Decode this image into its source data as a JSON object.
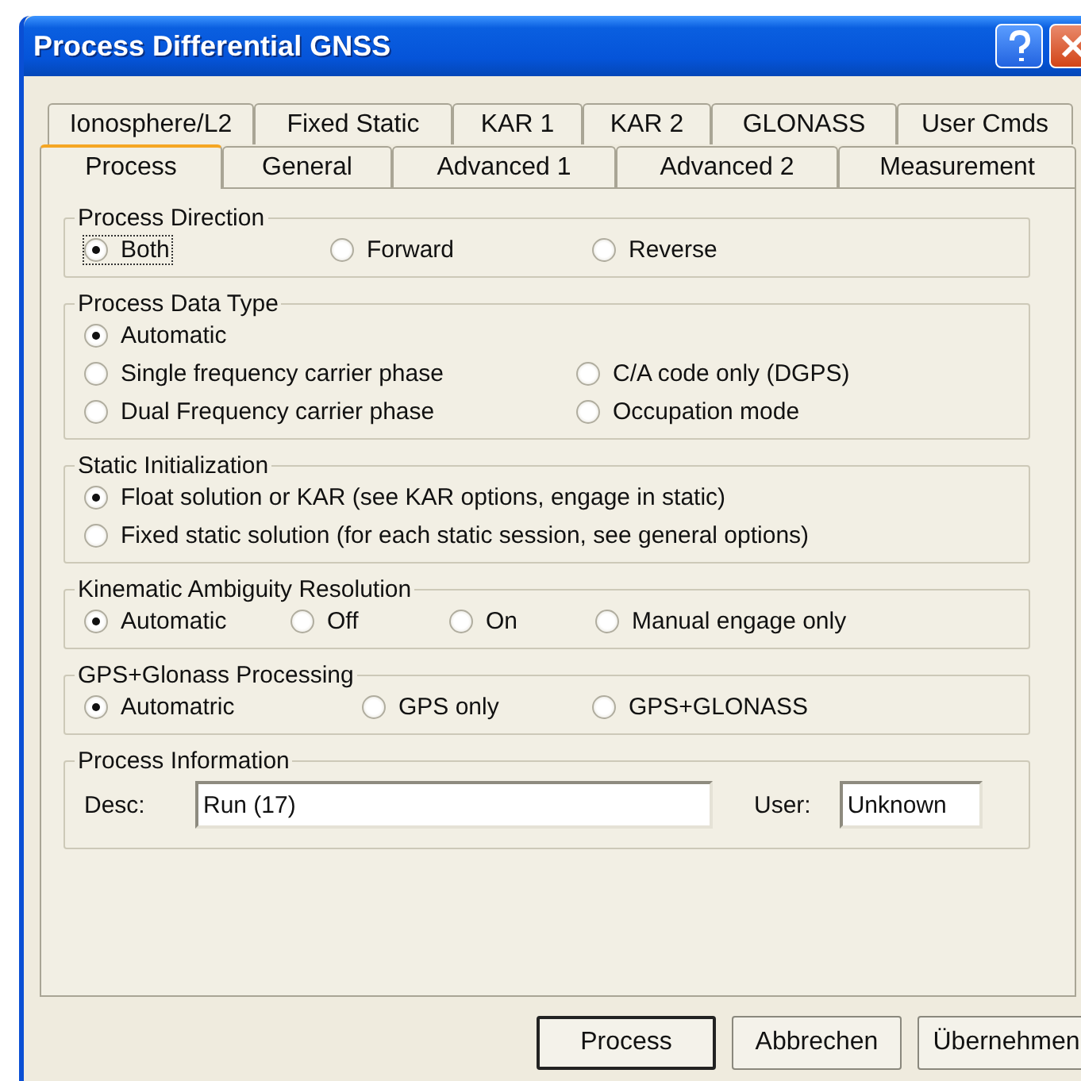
{
  "window": {
    "title": "Process Differential GNSS"
  },
  "tab_rows": [
    [
      {
        "label": "Ionosphere/L2",
        "selected": false
      },
      {
        "label": "Fixed Static",
        "selected": false
      },
      {
        "label": "KAR 1",
        "selected": false
      },
      {
        "label": "KAR 2",
        "selected": false
      },
      {
        "label": "GLONASS",
        "selected": false
      },
      {
        "label": "User Cmds",
        "selected": false
      }
    ],
    [
      {
        "label": "Process",
        "selected": true
      },
      {
        "label": "General",
        "selected": false
      },
      {
        "label": "Advanced 1",
        "selected": false
      },
      {
        "label": "Advanced 2",
        "selected": false
      },
      {
        "label": "Measurement",
        "selected": false
      }
    ]
  ],
  "groups": [
    {
      "title": "Process Direction",
      "rows": [
        [
          {
            "label": "Both",
            "selected": true,
            "focused": true
          },
          {
            "label": "Forward",
            "selected": false
          },
          {
            "label": "Reverse",
            "selected": false
          }
        ]
      ]
    },
    {
      "title": "Process Data Type",
      "rows": [
        [
          {
            "label": "Automatic",
            "selected": true
          }
        ],
        [
          {
            "label": "Single frequency carrier phase",
            "selected": false
          },
          {
            "label": "C/A code only (DGPS)",
            "selected": false
          }
        ],
        [
          {
            "label": "Dual Frequency carrier phase",
            "selected": false
          },
          {
            "label": "Occupation mode",
            "selected": false
          }
        ]
      ]
    },
    {
      "title": "Static Initialization",
      "rows": [
        [
          {
            "label": "Float solution or KAR (see KAR options, engage in static)",
            "selected": true
          }
        ],
        [
          {
            "label": "Fixed static solution (for each static session, see general options)",
            "selected": false
          }
        ]
      ]
    },
    {
      "title": "Kinematic Ambiguity Resolution",
      "rows": [
        [
          {
            "label": "Automatic",
            "selected": true
          },
          {
            "label": "Off",
            "selected": false
          },
          {
            "label": "On",
            "selected": false
          },
          {
            "label": "Manual engage only",
            "selected": false
          }
        ]
      ]
    },
    {
      "title": "GPS+Glonass Processing",
      "rows": [
        [
          {
            "label": "Automatric",
            "selected": true
          },
          {
            "label": "GPS only",
            "selected": false
          },
          {
            "label": "GPS+GLONASS",
            "selected": false
          }
        ]
      ]
    }
  ],
  "process_information": {
    "title": "Process Information",
    "desc_label": "Desc:",
    "desc_value": "Run (17)",
    "user_label": "User:",
    "user_value": "Unknown"
  },
  "buttons": [
    {
      "label": "Process",
      "default": true
    },
    {
      "label": "Abbrechen",
      "default": false
    },
    {
      "label": "Übernehmen",
      "default": false
    }
  ]
}
